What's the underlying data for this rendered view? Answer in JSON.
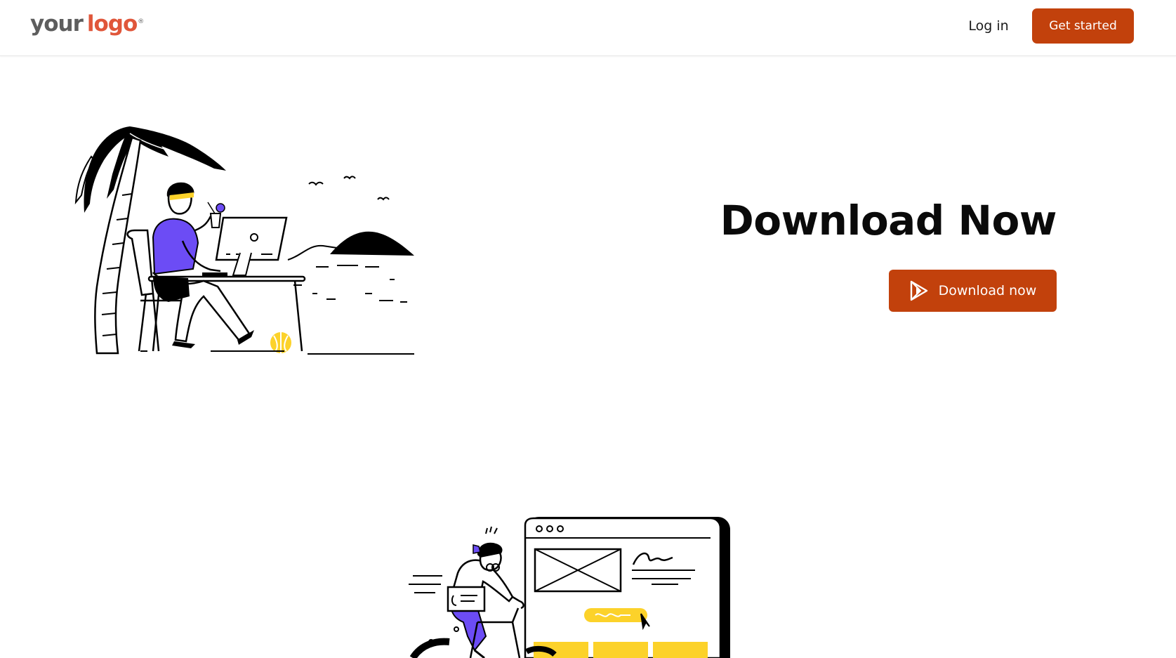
{
  "header": {
    "logo": {
      "word1": "your",
      "word2": "logo",
      "mark": "®"
    },
    "login_label": "Log in",
    "get_started_label": "Get started"
  },
  "hero": {
    "title": "Download Now",
    "download_label": "Download now",
    "download_icon": "play-store-icon"
  },
  "colors": {
    "accent": "#c2410c",
    "illustration_purple": "#6c4cf5",
    "illustration_yellow": "#fcd22a",
    "text": "#0a0a0a"
  }
}
